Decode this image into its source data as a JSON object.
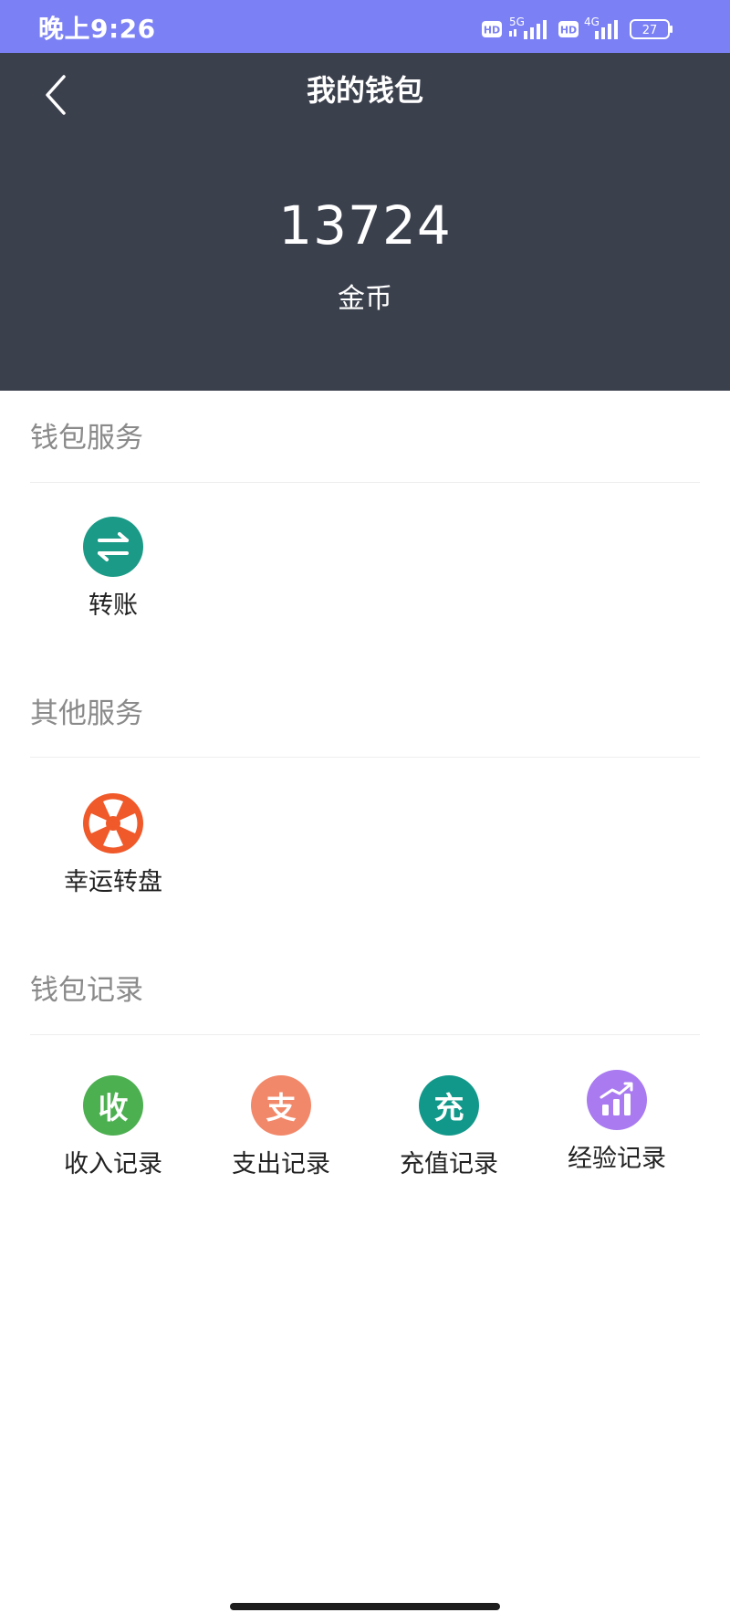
{
  "status_bar": {
    "time": "晚上9:26",
    "hd_badge_1": "HD",
    "network_1": "5G",
    "hd_badge_2": "HD",
    "network_2": "4G",
    "battery": "27"
  },
  "header": {
    "title": "我的钱包",
    "balance": "13724",
    "balance_label": "金币"
  },
  "sections": {
    "wallet_services": {
      "title": "钱包服务",
      "items": [
        {
          "label": "转账",
          "icon": "transfer-icon",
          "color": "#1a9a87"
        }
      ]
    },
    "other_services": {
      "title": "其他服务",
      "items": [
        {
          "label": "幸运转盘",
          "icon": "lucky-wheel-icon",
          "color": "#f0592a"
        }
      ]
    },
    "wallet_records": {
      "title": "钱包记录",
      "items": [
        {
          "label": "收入记录",
          "glyph": "收",
          "icon": "income-icon",
          "color": "#4caf50"
        },
        {
          "label": "支出记录",
          "glyph": "支",
          "icon": "expense-icon",
          "color": "#f2886a"
        },
        {
          "label": "充值记录",
          "glyph": "充",
          "icon": "recharge-icon",
          "color": "#12988a"
        },
        {
          "label": "经验记录",
          "icon": "experience-chart-icon",
          "color": "#a97af0"
        }
      ]
    }
  }
}
